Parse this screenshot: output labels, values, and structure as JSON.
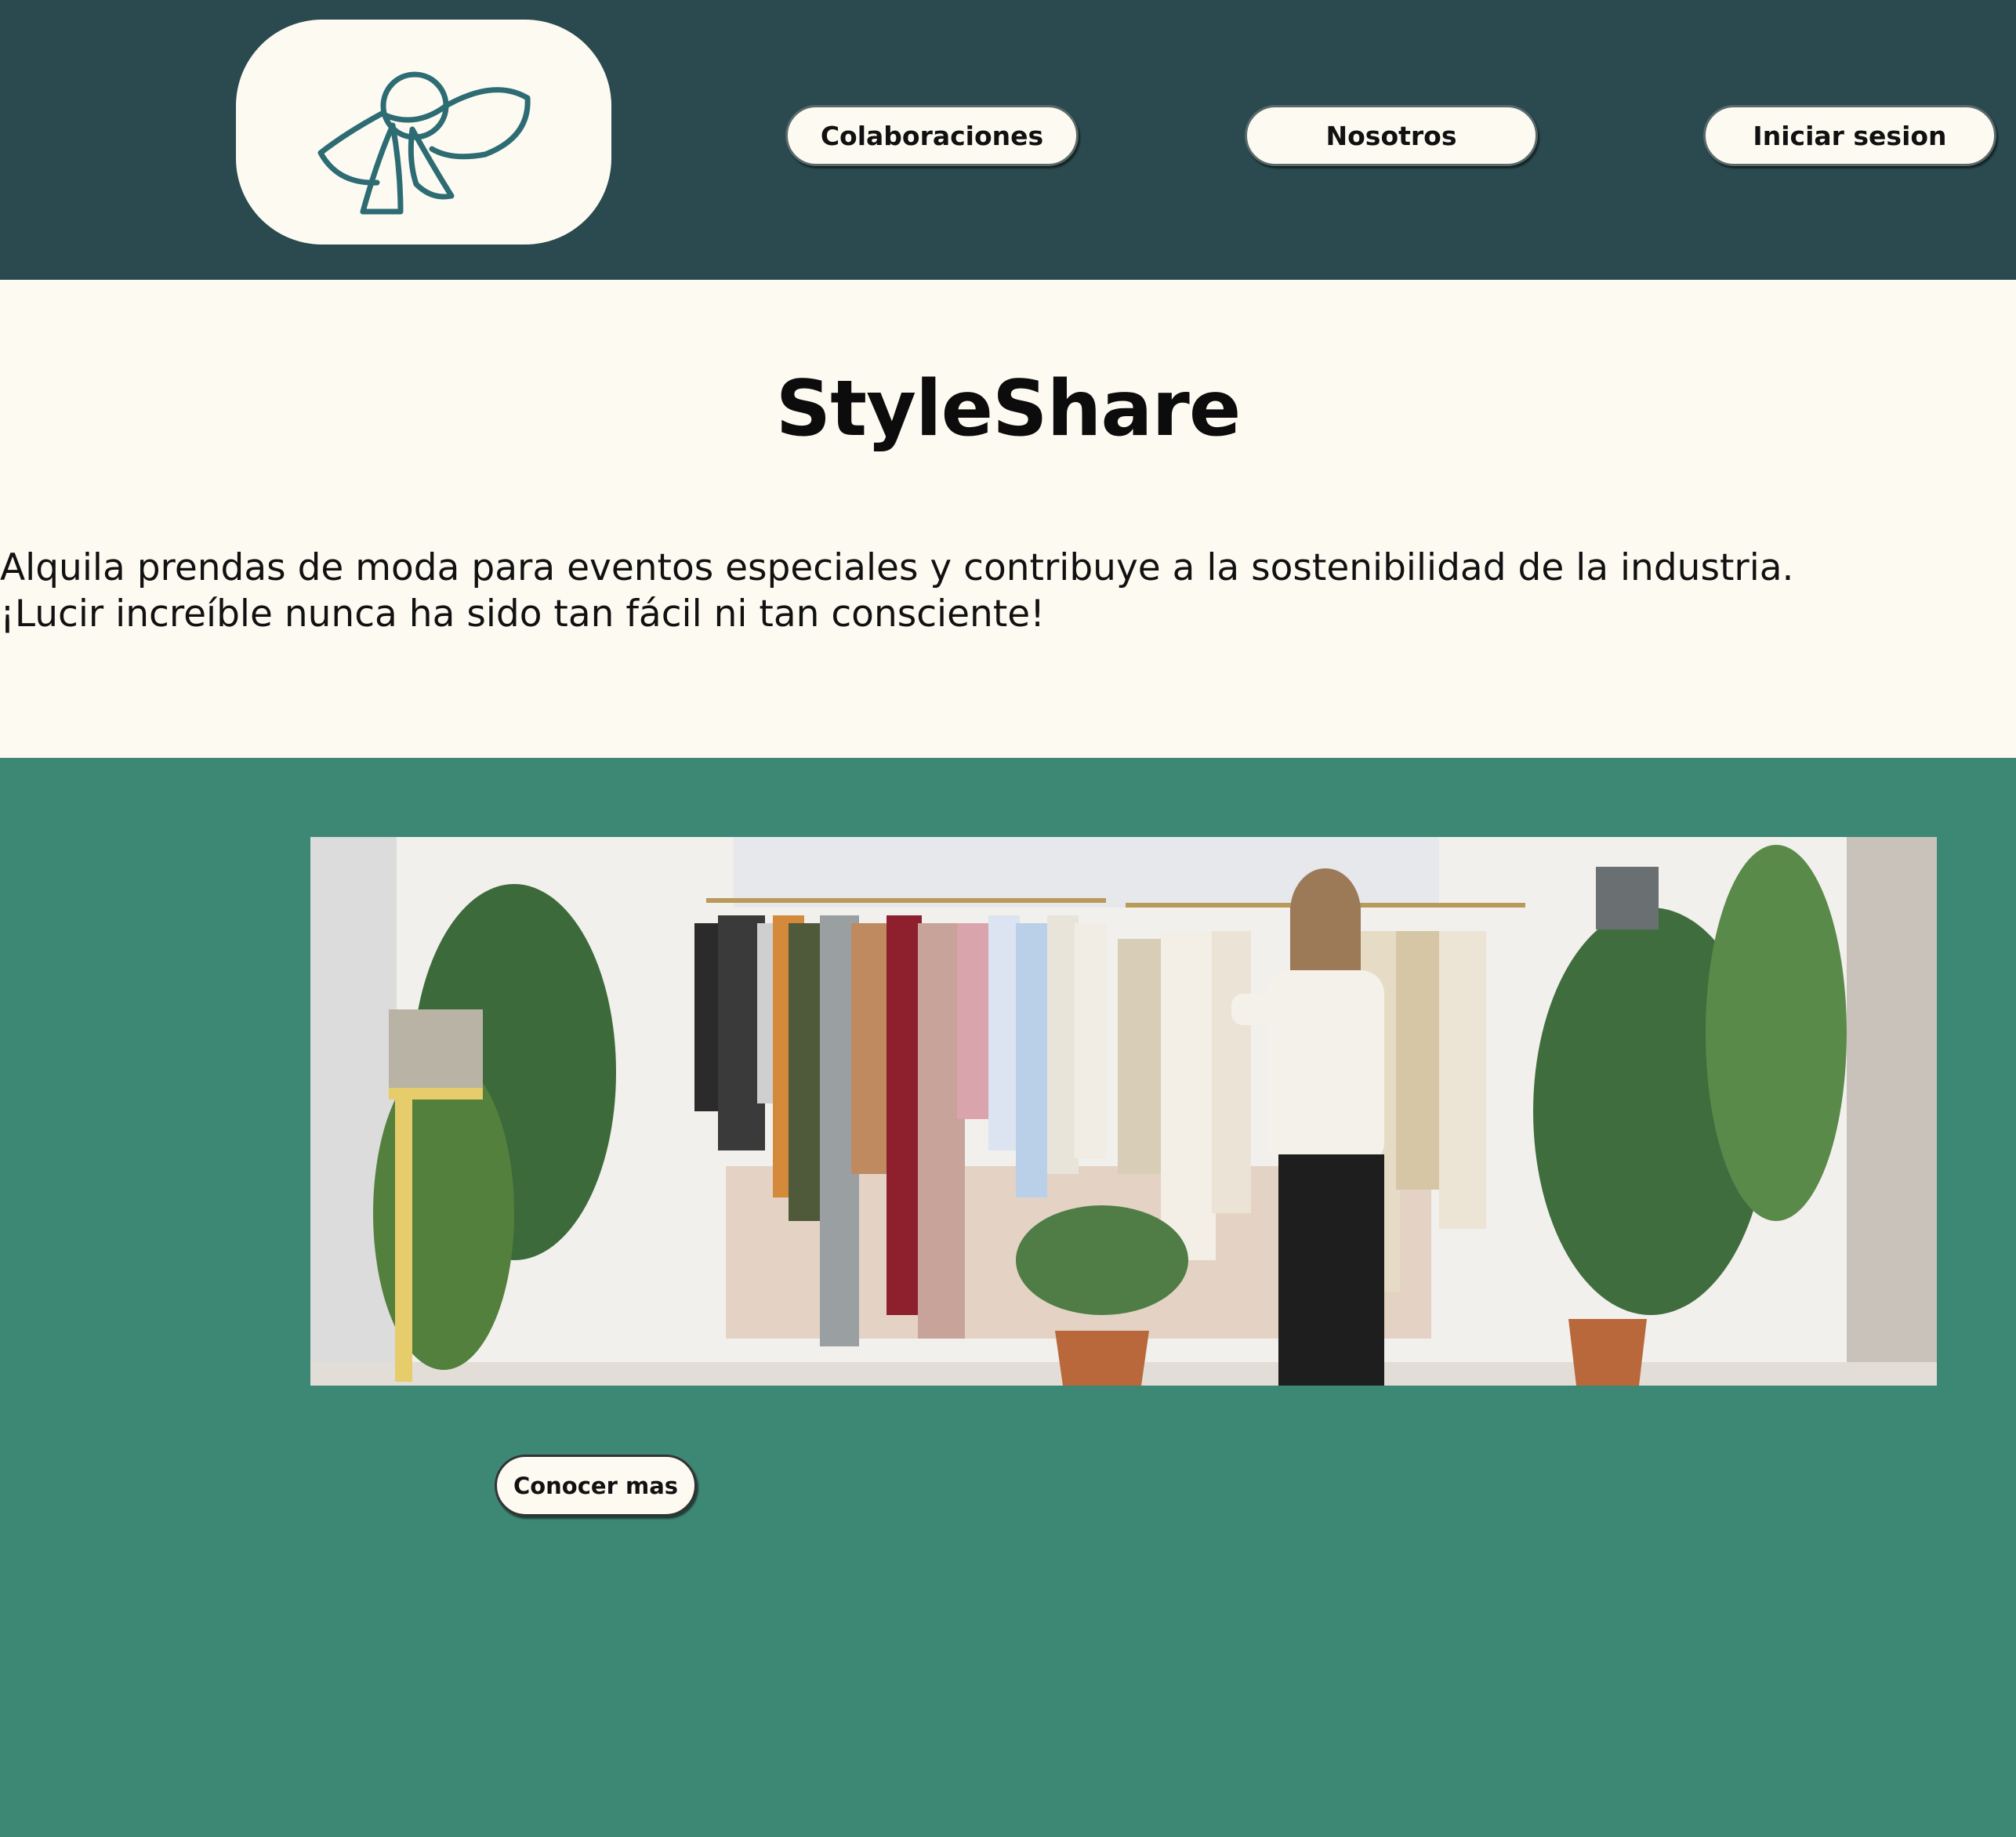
{
  "header": {
    "logo_icon": "hat-scarf-icon",
    "brand_color": "#2a4a50",
    "nav": [
      {
        "label": "Colaboraciones"
      },
      {
        "label": "Nosotros"
      },
      {
        "label": "Iniciar sesion"
      }
    ]
  },
  "hero": {
    "title": "StyleShare",
    "description": "Alquila prendas de moda para eventos especiales y contribuye a la sostenibilidad de la industria. ¡Lucir increíble nunca ha sido tan fácil ni tan consciente!"
  },
  "feature": {
    "background_color": "#3d8875",
    "image_subject": "clothing-rack-photo",
    "cta_label": "Conocer mas"
  }
}
